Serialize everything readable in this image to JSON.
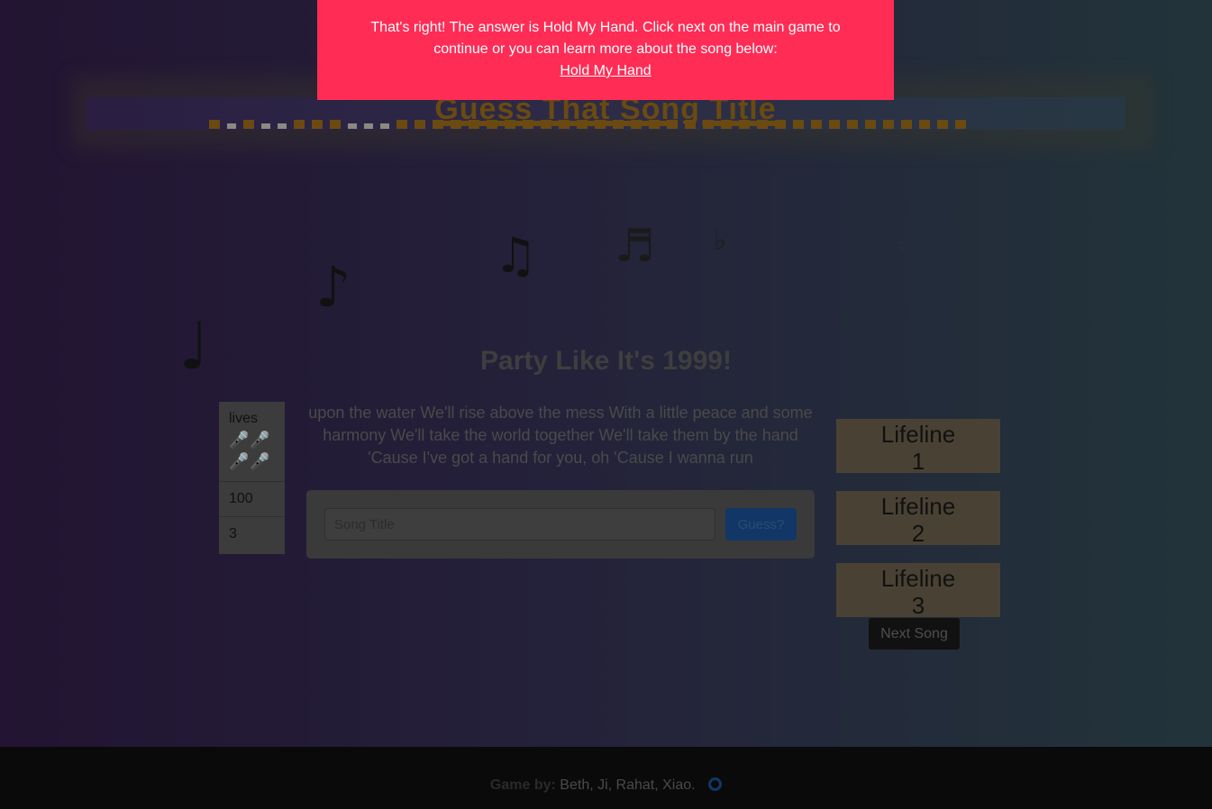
{
  "header": {
    "title": "Guess That Song Title"
  },
  "game": {
    "title": "Party Like It's 1999!",
    "lyrics": "upon the water We'll rise above the mess  With a little peace and some harmony We'll take the world together We'll take them by the hand  'Cause I've got a hand for you, oh 'Cause I wanna run",
    "stats": {
      "lives_label": "lives",
      "lives_icons": "🎤🎤🎤🎤",
      "score": "100",
      "round": "3"
    },
    "guess": {
      "placeholder": "Song Title",
      "button_label": "Guess?"
    },
    "lifelines": [
      {
        "label": "Lifeline",
        "number": "1"
      },
      {
        "label": "Lifeline",
        "number": "2"
      },
      {
        "label": "Lifeline",
        "number": "3"
      }
    ],
    "next_label": "Next Song"
  },
  "notes": {
    "quarter": "♩",
    "eighth": "♪",
    "beamed": "♫",
    "sixteenth": "♬",
    "flat": "♭",
    "natural": "♮"
  },
  "toast": {
    "message": "That's right! The answer is Hold My Hand. Click next on the main game to continue or you can learn more about the song below:",
    "link_text": "Hold My Hand"
  },
  "footer": {
    "by_label": "Game by:",
    "names": "Beth, Ji, Rahat, Xiao.",
    "icon": "github-icon"
  },
  "colors": {
    "toast_bg": "#ff2c55",
    "guess_button": "#123766",
    "footer_bg": "#0a0a0a"
  }
}
